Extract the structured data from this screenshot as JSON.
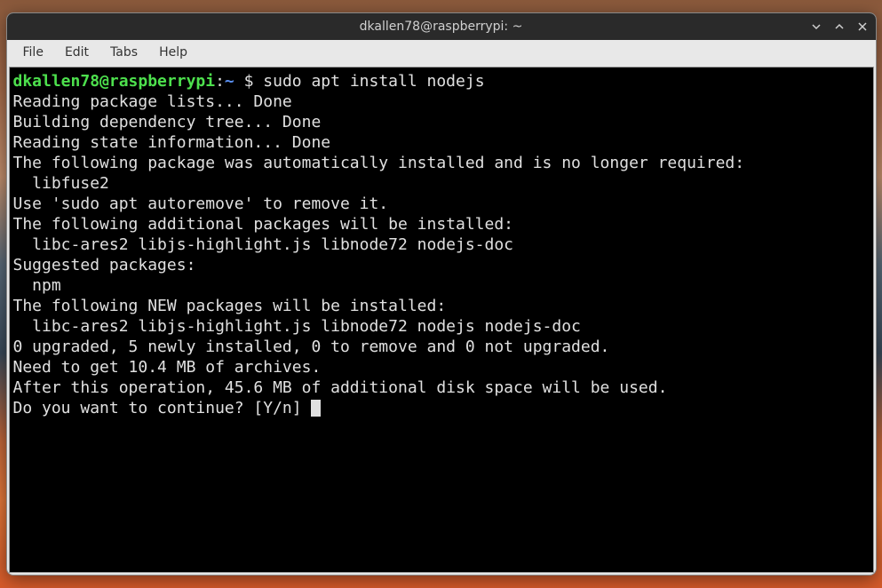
{
  "titlebar": {
    "title": "dkallen78@raspberrypi: ~"
  },
  "menubar": {
    "items": [
      "File",
      "Edit",
      "Tabs",
      "Help"
    ]
  },
  "prompt": {
    "user_host": "dkallen78@raspberrypi",
    "separator": ":",
    "path": "~",
    "dollar": " $ ",
    "command": "sudo apt install nodejs"
  },
  "output": {
    "lines": [
      "Reading package lists... Done",
      "Building dependency tree... Done",
      "Reading state information... Done",
      "The following package was automatically installed and is no longer required:",
      "  libfuse2",
      "Use 'sudo apt autoremove' to remove it.",
      "The following additional packages will be installed:",
      "  libc-ares2 libjs-highlight.js libnode72 nodejs-doc",
      "Suggested packages:",
      "  npm",
      "The following NEW packages will be installed:",
      "  libc-ares2 libjs-highlight.js libnode72 nodejs nodejs-doc",
      "0 upgraded, 5 newly installed, 0 to remove and 0 not upgraded.",
      "Need to get 10.4 MB of archives.",
      "After this operation, 45.6 MB of additional disk space will be used.",
      "Do you want to continue? [Y/n] "
    ]
  }
}
